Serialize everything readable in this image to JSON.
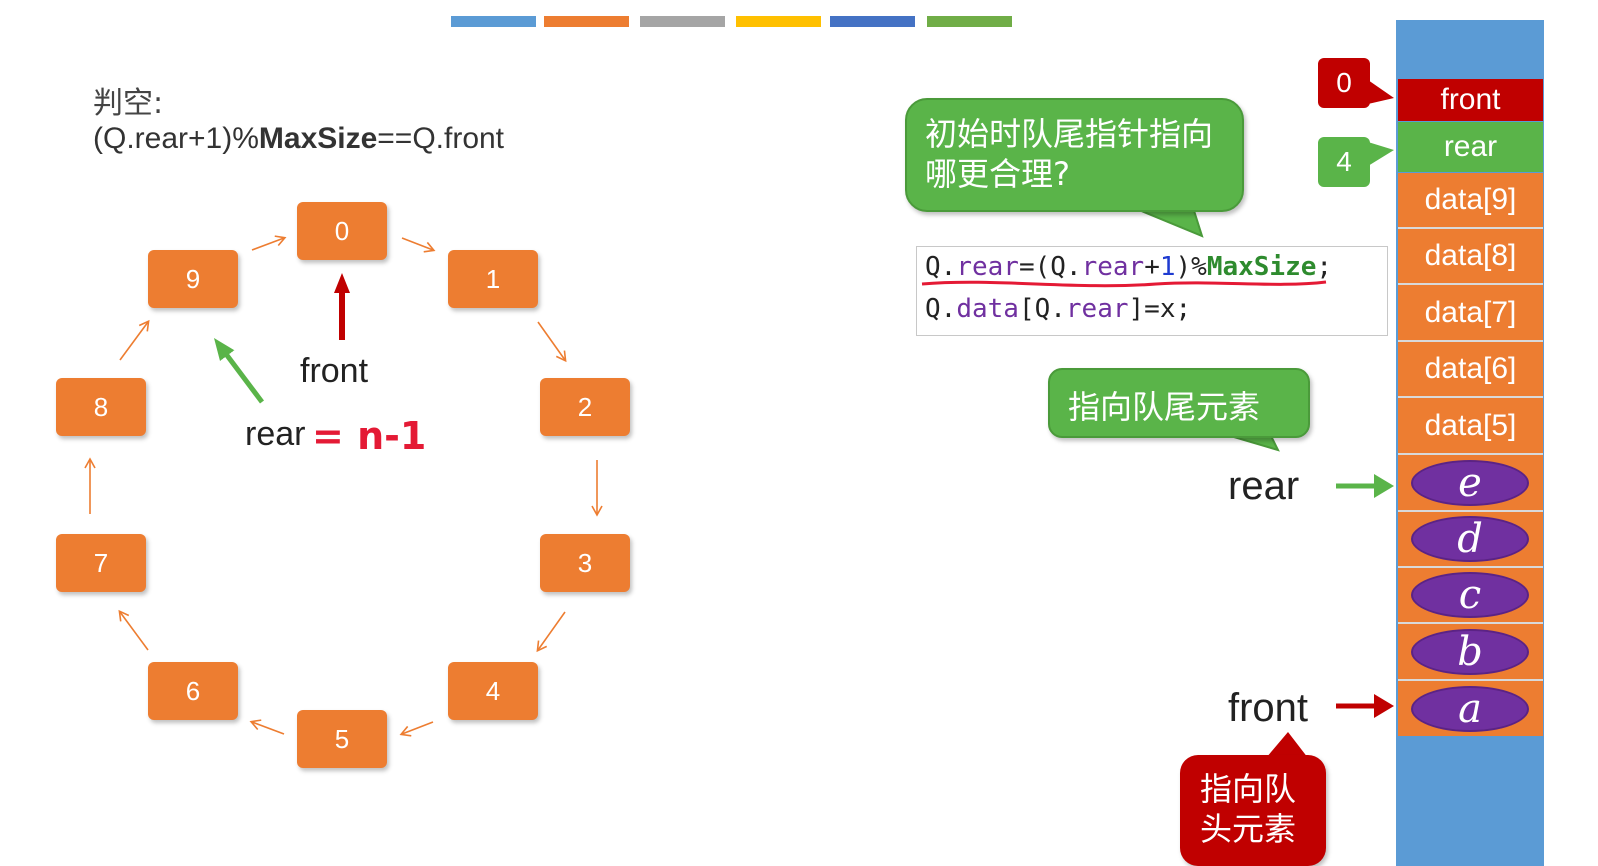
{
  "top_bar_colors": [
    "#5b9bd5",
    "#ed7d31",
    "#a5a5a5",
    "#ffc000",
    "#4472c4",
    "#70ad47"
  ],
  "condition": {
    "label": "判空:",
    "formula_prefix": "(Q.rear+1)%",
    "formula_bold": "MaxSize",
    "formula_suffix": "==Q.front"
  },
  "ring": {
    "nodes": [
      "0",
      "1",
      "2",
      "3",
      "4",
      "5",
      "6",
      "7",
      "8",
      "9"
    ],
    "front_label": "front",
    "rear_label": "rear",
    "rear_annotation": "= n-1"
  },
  "question_bubble": "初始时队尾指针指向哪更合理?",
  "code": {
    "line1": {
      "q1": "Q.",
      "rear1": "rear",
      "eq": "=(Q.",
      "rear2": "rear",
      "plus": "+",
      "one": "1",
      "mod": ")%",
      "maxsize": "MaxSize",
      "semi": ";"
    },
    "line2": {
      "q": "Q.",
      "data": "data",
      "bracket": "[Q.",
      "rear": "rear",
      "rest": "]=x;"
    }
  },
  "tail_bubble": "指向队尾元素",
  "memory": {
    "front_pointer_value": "0",
    "rear_pointer_value": "4",
    "front_cell": "front",
    "rear_cell": "rear",
    "slots": [
      "data[9]",
      "data[8]",
      "data[7]",
      "data[6]",
      "data[5]"
    ],
    "elements": [
      "e",
      "d",
      "c",
      "b",
      "a"
    ]
  },
  "side_labels": {
    "rear": "rear",
    "front": "front"
  },
  "head_bubble_line1": "指向队",
  "head_bubble_line2": "头元素",
  "colors": {
    "orange": "#ed7d31",
    "green": "#5ab449",
    "red": "#c00000",
    "purple": "#7030a0",
    "blue": "#5b9bd5"
  }
}
